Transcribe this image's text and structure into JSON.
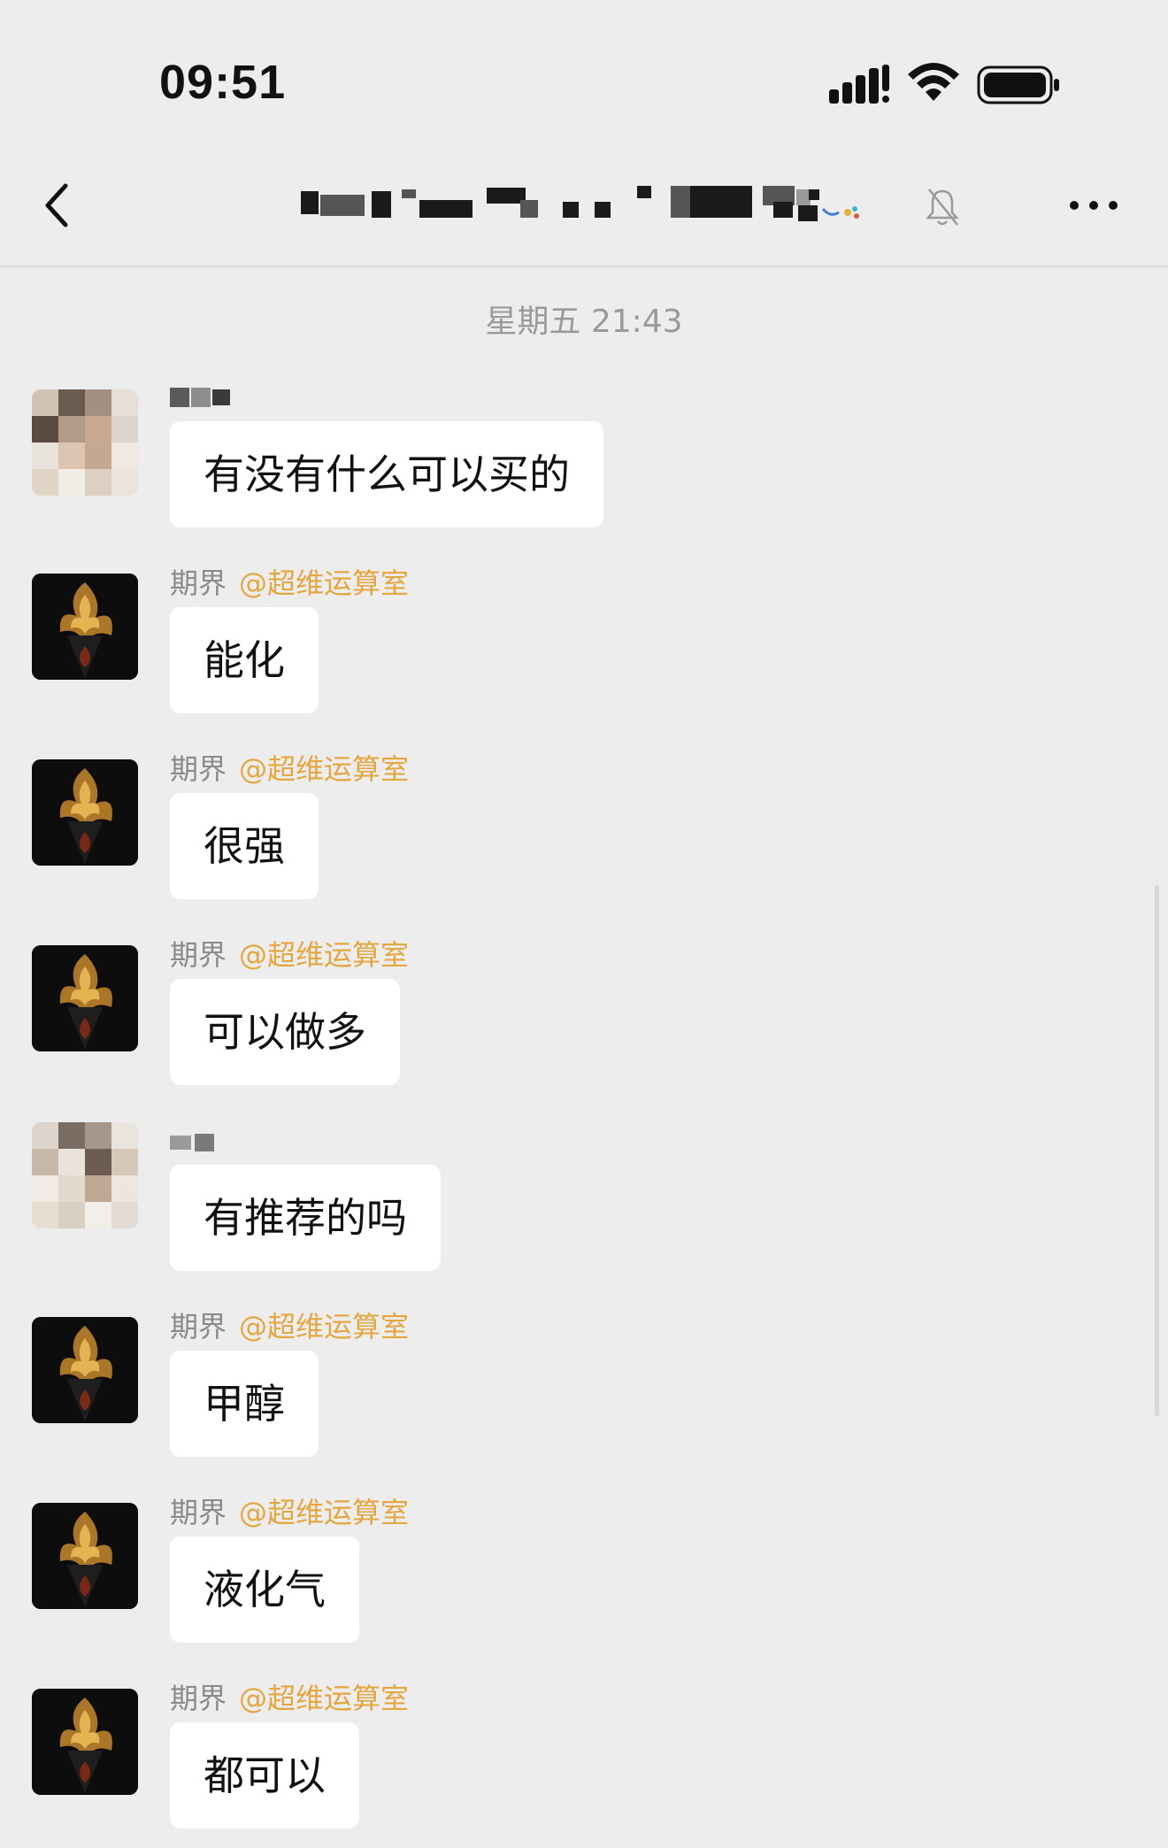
{
  "status_bar": {
    "time": "09:51",
    "icons": [
      "signal-icon",
      "wifi-icon",
      "battery-icon"
    ]
  },
  "nav": {
    "back_icon": "chevron-left-icon",
    "mute_icon": "bell-slash-icon",
    "more_icon": "ellipsis-icon"
  },
  "timestamp": "星期五 21:43",
  "messages": [
    {
      "sender": "",
      "mention": "",
      "text": "有没有什么可以买的",
      "avatar": "blurred"
    },
    {
      "sender": "期界",
      "mention": "@超维运算室",
      "text": "能化",
      "avatar": "dark"
    },
    {
      "sender": "期界",
      "mention": "@超维运算室",
      "text": "很强",
      "avatar": "dark"
    },
    {
      "sender": "期界",
      "mention": "@超维运算室",
      "text": "可以做多",
      "avatar": "dark"
    },
    {
      "sender": "",
      "mention": "",
      "text": "有推荐的吗",
      "avatar": "blurred"
    },
    {
      "sender": "期界",
      "mention": "@超维运算室",
      "text": "甲醇",
      "avatar": "dark"
    },
    {
      "sender": "期界",
      "mention": "@超维运算室",
      "text": "液化气",
      "avatar": "dark"
    },
    {
      "sender": "期界",
      "mention": "@超维运算室",
      "text": "都可以",
      "avatar": "dark"
    }
  ],
  "colors": {
    "background": "#ededed",
    "bubble": "#ffffff",
    "mention": "#e5a63f",
    "meta_text": "#8a8a8a"
  }
}
